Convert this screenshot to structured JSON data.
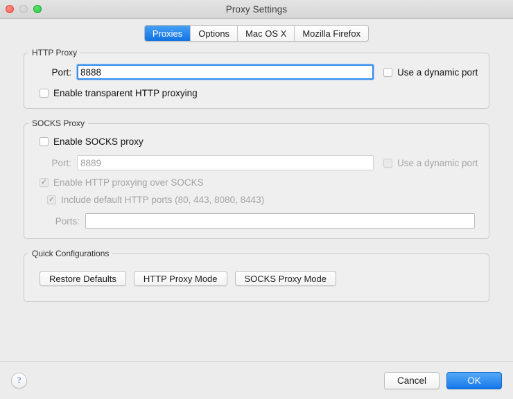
{
  "window": {
    "title": "Proxy Settings",
    "traffic_lights": [
      "close-button",
      "minimize-button",
      "zoom-button"
    ]
  },
  "tabs": [
    {
      "label": "Proxies",
      "selected": true
    },
    {
      "label": "Options",
      "selected": false
    },
    {
      "label": "Mac OS X",
      "selected": false
    },
    {
      "label": "Mozilla Firefox",
      "selected": false
    }
  ],
  "http_proxy": {
    "legend": "HTTP Proxy",
    "port_label": "Port:",
    "port_value": "8888",
    "dynamic_port_label": "Use a dynamic port",
    "dynamic_port_checked": false,
    "transparent_label": "Enable transparent HTTP proxying",
    "transparent_checked": false
  },
  "socks_proxy": {
    "legend": "SOCKS Proxy",
    "enable_label": "Enable SOCKS proxy",
    "enable_checked": false,
    "port_label": "Port:",
    "port_value": "8889",
    "dynamic_port_label": "Use a dynamic port",
    "dynamic_port_checked": false,
    "http_over_socks_label": "Enable HTTP proxying over SOCKS",
    "http_over_socks_checked": true,
    "default_ports_label": "Include default HTTP ports (80, 443, 8080, 8443)",
    "default_ports_checked": true,
    "ports_label": "Ports:",
    "ports_value": ""
  },
  "quick_configurations": {
    "legend": "Quick Configurations",
    "buttons": [
      {
        "label": "Restore Defaults"
      },
      {
        "label": "HTTP Proxy Mode"
      },
      {
        "label": "SOCKS Proxy Mode"
      }
    ]
  },
  "footer": {
    "help_label": "?",
    "cancel_label": "Cancel",
    "ok_label": "OK"
  },
  "colors": {
    "accent": "#1478ea",
    "tab_selected": "#1072e4",
    "focus_ring": "#3a8ef0",
    "disabled_text": "#a3a3a3",
    "window_bg": "#ececec"
  },
  "check_glyph": "✓"
}
